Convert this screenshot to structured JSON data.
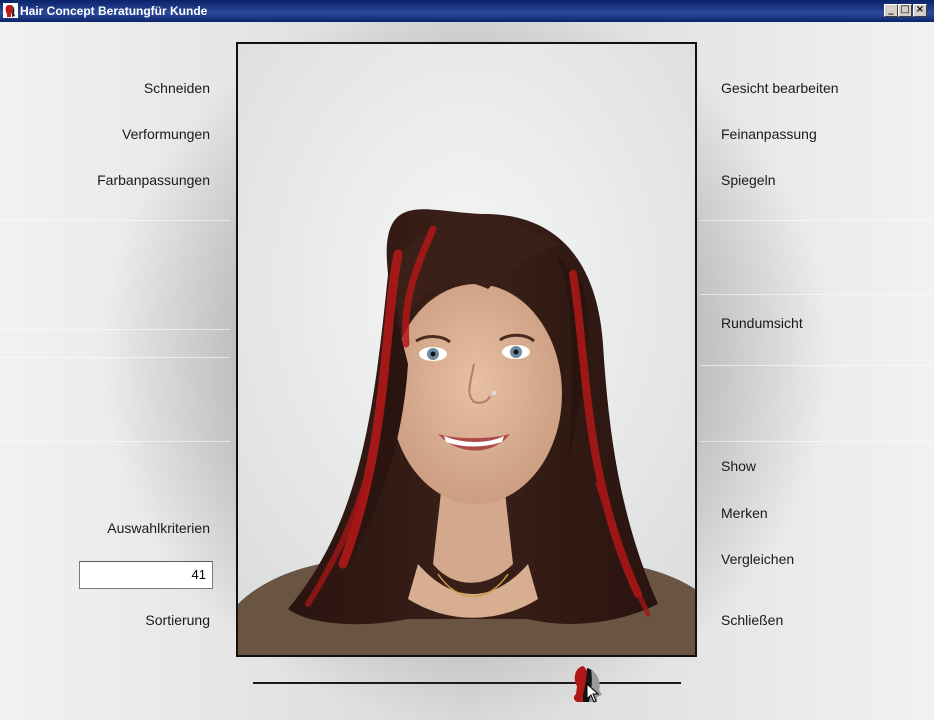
{
  "window": {
    "title": "Hair Concept Beratungfür Kunde"
  },
  "left_menu": {
    "schneiden": "Schneiden",
    "verformungen": "Verformungen",
    "farbanpassungen": "Farbanpassungen",
    "auswahlkriterien": "Auswahlkriterien",
    "sortierung": "Sortierung"
  },
  "count_field": {
    "value": "41"
  },
  "right_menu": {
    "gesicht": "Gesicht bearbeiten",
    "feinanpassung": "Feinanpassung",
    "spiegeln": "Spiegeln",
    "rundumsicht": "Rundumsicht",
    "show": "Show",
    "merken": "Merken",
    "vergleichen": "Vergleichen",
    "schliessen": "Schließen"
  },
  "slider": {
    "position": 0.78
  },
  "icons": {
    "app": "hair-concept-logo-icon",
    "minimize": "minimize-icon",
    "maximize": "maximize-icon",
    "close": "close-icon",
    "thumb": "head-silhouette-icon",
    "cursor": "mouse-cursor-icon"
  },
  "colors": {
    "titlebar": "#0a246a",
    "hair_highlight": "#b01818",
    "hair_base": "#3a2018"
  }
}
